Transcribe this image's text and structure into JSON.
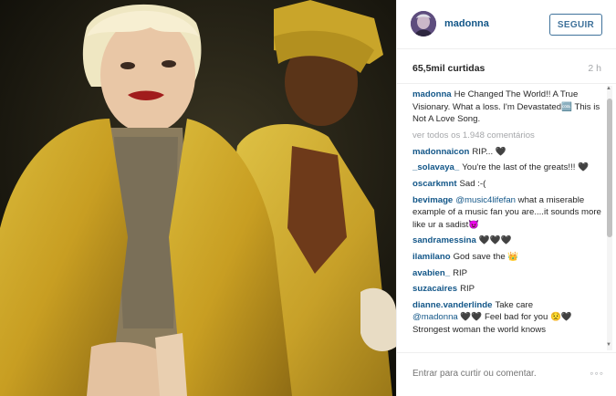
{
  "header": {
    "username": "madonna",
    "follow_label": "SEGUIR"
  },
  "meta": {
    "likes": "65,5mil curtidas",
    "age": "2 h"
  },
  "caption": {
    "user": "madonna",
    "text": "He Changed The World!! A True Visionary. What a loss. I'm Devastated🆒 This is Not A Love Song."
  },
  "view_all": "ver todos os 1.948 comentários",
  "comments": [
    {
      "user": "madonnaicon",
      "text": "RIP... 🖤"
    },
    {
      "user": "_solavaya_",
      "text": "You're the last of the greats!!! 🖤"
    },
    {
      "user": "oscarkmnt",
      "text": "Sad :-("
    },
    {
      "user": "bevimage",
      "mention": "@music4lifefan",
      "text": "what a miserable example of a music fan you are....it sounds more like ur a sadist😈"
    },
    {
      "user": "sandramessina",
      "text": "🖤🖤🖤"
    },
    {
      "user": "ilamilano",
      "text": "God save the 👑"
    },
    {
      "user": "avabien_",
      "text": "RIP"
    },
    {
      "user": "suzacaires",
      "text": "RIP"
    },
    {
      "user": "dianne.vanderlinde",
      "text": "Take care",
      "mention": "@madonna",
      "text2": "🖤🖤 Feel bad for you 😟🖤 Strongest woman the world knows"
    }
  ],
  "footer": {
    "placeholder": "Entrar para curtir ou comentar.",
    "more_icon": "◦◦◦"
  },
  "colors": {
    "link": "#125688",
    "button": "#3f729b",
    "muted": "#a5a7aa",
    "coat": "#c9a52a"
  }
}
